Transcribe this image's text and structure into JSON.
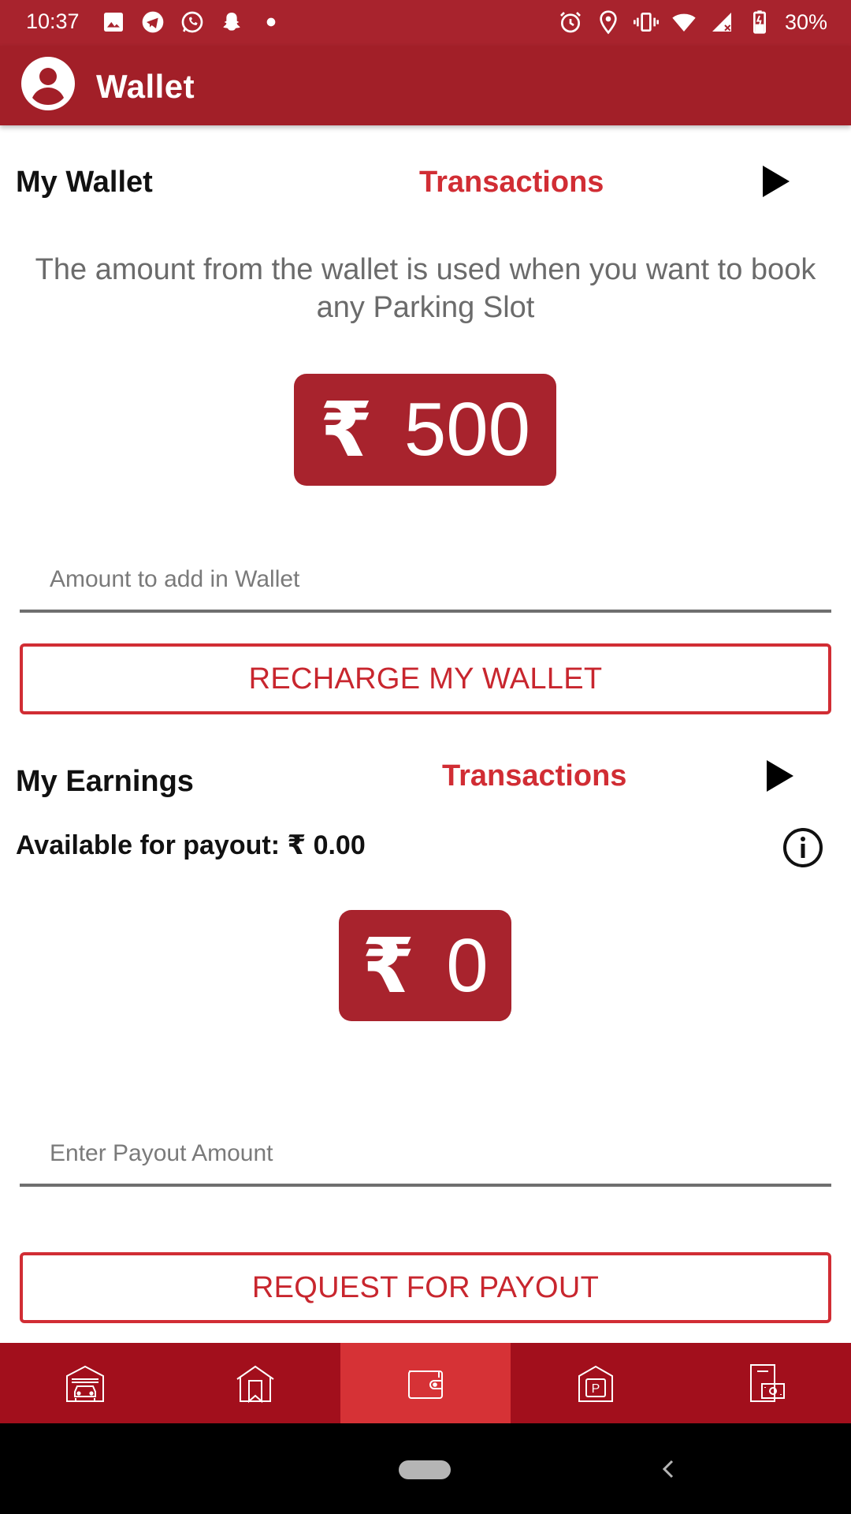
{
  "status_bar": {
    "time": "10:37",
    "battery": "30%",
    "left_icons": [
      "gallery-icon",
      "telegram-icon",
      "whatsapp-icon",
      "snapchat-icon",
      "dot-icon"
    ],
    "right_icons": [
      "alarm-icon",
      "location-icon",
      "vibrate-icon",
      "wifi-icon",
      "signal-icon",
      "battery-icon"
    ]
  },
  "app_bar": {
    "title": "Wallet",
    "avatar_icon": "account-circle-icon"
  },
  "wallet": {
    "title": "My Wallet",
    "transactions_label": "Transactions",
    "description": "The amount from the wallet is used when you want to book any Parking Slot",
    "currency_symbol": "₹",
    "balance": "500",
    "amount_placeholder": "Amount to add in Wallet",
    "recharge_label": "RECHARGE MY WALLET"
  },
  "earnings": {
    "title": "My Earnings",
    "transactions_label": "Transactions",
    "available_payout": "Available for payout: ₹ 0.00",
    "currency_symbol": "₹",
    "balance": "0",
    "payout_placeholder": "Enter Payout Amount",
    "payout_label": "REQUEST FOR PAYOUT"
  },
  "bottom_nav": {
    "items": [
      {
        "icon": "garage-car-icon",
        "active": false
      },
      {
        "icon": "home-bookmark-icon",
        "active": false
      },
      {
        "icon": "wallet-icon",
        "active": true
      },
      {
        "icon": "parking-icon",
        "active": false
      },
      {
        "icon": "cash-register-icon",
        "active": false
      }
    ]
  },
  "colors": {
    "primary": "#a8232d",
    "accent": "#d12d34",
    "nav_bg": "#a20f1c",
    "nav_active": "#d63236"
  }
}
